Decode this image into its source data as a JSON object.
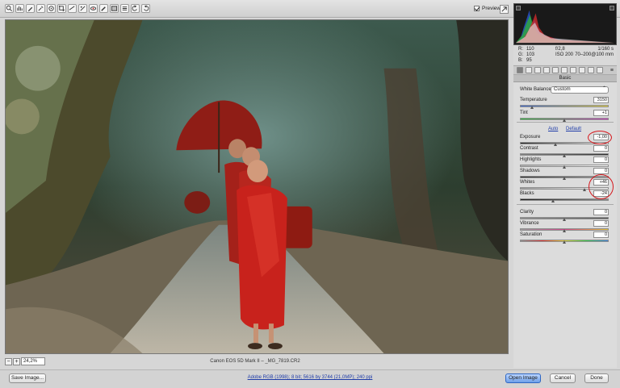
{
  "toolbar": {
    "tools": [
      "zoom-icon",
      "hand-icon",
      "white-balance-icon",
      "color-sampler-icon",
      "targeted-adjustment-icon",
      "crop-icon",
      "straighten-icon",
      "spot-removal-icon",
      "red-eye-icon",
      "adjustment-brush-icon",
      "graduated-filter-icon",
      "preferences-icon",
      "rotate-left-icon",
      "rotate-right-icon"
    ],
    "preview_label": "Preview"
  },
  "readout": {
    "r": "110",
    "g": "103",
    "b": "95",
    "r_label": "R:",
    "g_label": "G:",
    "b_label": "B:",
    "aperture": "f/2,8",
    "shutter": "1/160 s",
    "iso": "ISO 200",
    "lens": "70–200@100 mm"
  },
  "panel": {
    "title": "Basic",
    "white_balance_label": "White Balance:",
    "white_balance_value": "Custom",
    "auto_label": "Auto",
    "default_label": "Default",
    "sliders": [
      {
        "name": "temperature",
        "label": "Temperature",
        "value": "3150",
        "level": 0.14,
        "track": "linear-gradient(90deg,#3a67d6,#e7d23a)"
      },
      {
        "name": "tint",
        "label": "Tint",
        "value": "+1",
        "level": 0.5,
        "track": "linear-gradient(90deg,#2dbb3a,#d33fc4)"
      },
      {
        "name": "exposure",
        "label": "Exposure",
        "value": "-1,00",
        "level": 0.4,
        "track": "linear-gradient(90deg,#1f1f1f,#ffffff)"
      },
      {
        "name": "contrast",
        "label": "Contrast",
        "value": "0",
        "level": 0.5,
        "track": "linear-gradient(90deg,#808080,#333333)"
      },
      {
        "name": "highlights",
        "label": "Highlights",
        "value": "0",
        "level": 0.5,
        "track": "linear-gradient(90deg,#b0b0b0,#ffffff)"
      },
      {
        "name": "shadows",
        "label": "Shadows",
        "value": "0",
        "level": 0.5,
        "track": "linear-gradient(90deg,#2a2a2a,#a0a0a0)"
      },
      {
        "name": "whites",
        "label": "Whites",
        "value": "+46",
        "level": 0.73,
        "track": "linear-gradient(90deg,#9a9a9a,#ffffff)"
      },
      {
        "name": "blacks",
        "label": "Blacks",
        "value": "-24",
        "level": 0.38,
        "track": "linear-gradient(90deg,#1b1b1b,#8a8a8a)"
      },
      {
        "name": "clarity",
        "label": "Clarity",
        "value": "0",
        "level": 0.5,
        "track": "linear-gradient(90deg,#8e8e8e,#5a5a5a)"
      },
      {
        "name": "vibrance",
        "label": "Vibrance",
        "value": "0",
        "level": 0.5,
        "track": "linear-gradient(90deg,#9b9b9b,#d14b8e,#e6c33a)"
      },
      {
        "name": "saturation",
        "label": "Saturation",
        "value": "0",
        "level": 0.5,
        "track": "linear-gradient(90deg,#8f8f8f,#e23a3a,#e6d53a,#3ad14b,#3a82e6)"
      }
    ]
  },
  "status": {
    "zoom": "24,2%",
    "filename": "Canon EOS 5D Mark II  –  _MG_7819.CR2"
  },
  "bottom": {
    "save_label": "Save Image...",
    "workflow": "Adobe RGB (1998); 8 bit; 5616 by 3744 (21,0MP); 240 ppi",
    "open_label": "Open Image",
    "cancel_label": "Cancel",
    "done_label": "Done"
  },
  "colors": {
    "accent": "#6d9fe8",
    "annotation": "#d6191e"
  }
}
